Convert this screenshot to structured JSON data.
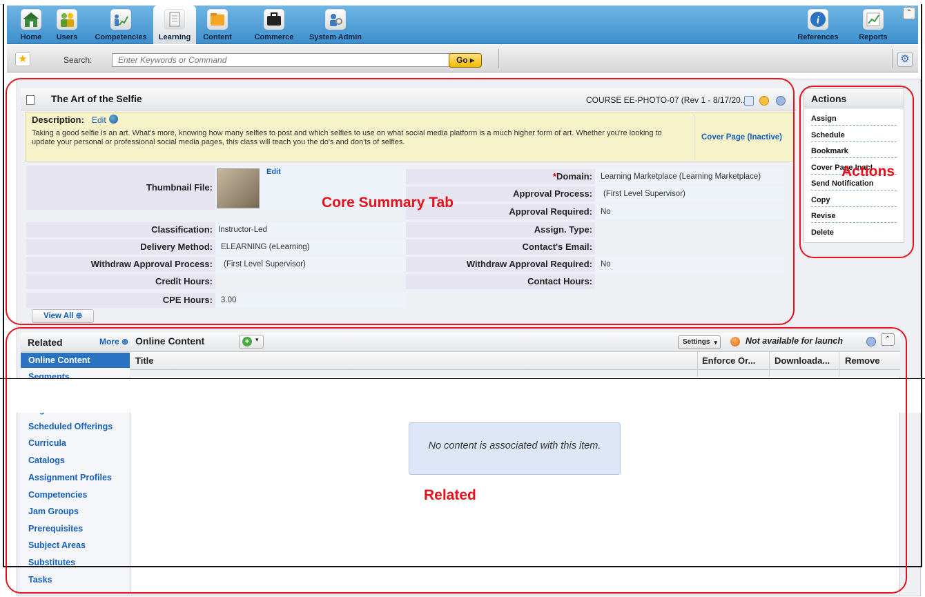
{
  "nav": {
    "items": [
      {
        "label": "Home",
        "icon": "home-icon"
      },
      {
        "label": "Users",
        "icon": "users-icon"
      },
      {
        "label": "Competencies",
        "icon": "competencies-icon"
      },
      {
        "label": "Learning",
        "icon": "learning-icon",
        "active": true
      },
      {
        "label": "Content",
        "icon": "content-folder-icon"
      },
      {
        "label": "Commerce",
        "icon": "briefcase-icon"
      },
      {
        "label": "System Admin",
        "icon": "system-admin-icon"
      }
    ],
    "right_items": [
      {
        "label": "References",
        "icon": "info-icon"
      },
      {
        "label": "Reports",
        "icon": "reports-icon"
      }
    ]
  },
  "search": {
    "label": "Search:",
    "placeholder": "Enter Keywords or Command",
    "go_label": "Go ▸"
  },
  "course": {
    "title": "The Art of the Selfie",
    "id_text": "COURSE EE-PHOTO-07 (Rev 1 - 8/17/20...",
    "description_label": "Description:",
    "description_edit": "Edit",
    "description": "Taking a good selfie is an art. What's more, knowing how many selfies to post and which selfies to use on what social media platform is a much higher form of art. Whether you're looking to update your personal or professional social media pages, this class will teach you the do's and don'ts of selfies.",
    "cover_page": "Cover Page (Inactive)",
    "thumbnail_edit": "Edit",
    "view_all": "View All"
  },
  "details_left": [
    {
      "label": "Thumbnail File:",
      "value": ""
    },
    {
      "label": "Classification:",
      "value": "Instructor-Led"
    },
    {
      "label": "Delivery Method:",
      "value": "ELEARNING (eLearning)"
    },
    {
      "label": "Withdraw Approval Process:",
      "value": "(First Level Supervisor)"
    },
    {
      "label": "Credit Hours:",
      "value": ""
    },
    {
      "label": "CPE Hours:",
      "value": "3.00"
    }
  ],
  "details_right": [
    {
      "label": "Domain:",
      "value": "Learning Marketplace (Learning Marketplace)",
      "required": "*"
    },
    {
      "label": "Approval Process:",
      "value": "(First Level Supervisor)"
    },
    {
      "label": "Approval Required:",
      "value": "No"
    },
    {
      "label": "Assign. Type:",
      "value": ""
    },
    {
      "label": "Contact's Email:",
      "value": ""
    },
    {
      "label": "Withdraw Approval Required:",
      "value": "No"
    },
    {
      "label": "Contact Hours:",
      "value": ""
    }
  ],
  "actions": {
    "title": "Actions",
    "items": [
      "Assign",
      "Schedule",
      "Bookmark",
      "Cover Page Inact",
      "Send Notification",
      "Copy",
      "Revise",
      "Delete"
    ]
  },
  "related": {
    "title": "Related",
    "more": "More",
    "items": [
      "Online Content",
      "Segments",
      "Registration",
      "Scheduled Offerings",
      "Curricula",
      "Catalogs",
      "Assignment Profiles",
      "Competencies",
      "Jam Groups",
      "Prerequisites",
      "Subject Areas",
      "Substitutes",
      "Tasks"
    ]
  },
  "online_content": {
    "title": "Online Content",
    "settings": "Settings",
    "status": "Not available for launch",
    "columns": [
      "Title",
      "Enforce Or...",
      "Downloada...",
      "Remove"
    ],
    "empty_message": "No content is associated with this item."
  },
  "annotations": {
    "core": "Core Summary Tab",
    "actions": "Actions",
    "related": "Related"
  },
  "colors": {
    "nav_blue": "#3d8fcc",
    "link_blue": "#1560bd",
    "annotation_red": "#e8101a",
    "description_bg": "#f6f2c9"
  }
}
